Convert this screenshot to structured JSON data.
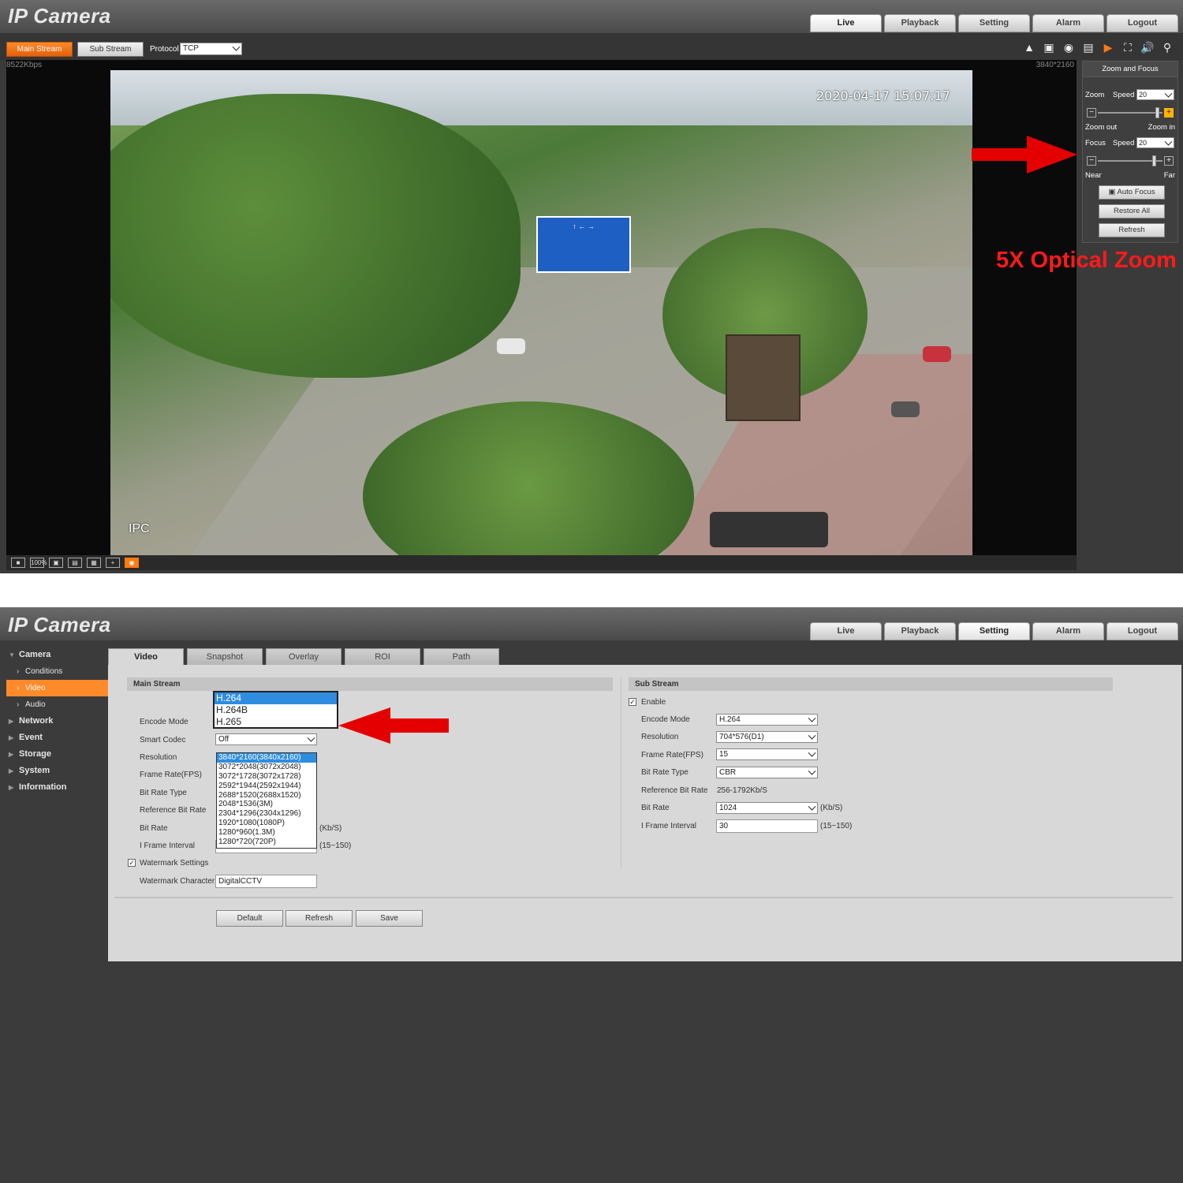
{
  "top": {
    "logo": "IP Camera",
    "nav": [
      "Live",
      "Playback",
      "Setting",
      "Alarm",
      "Logout"
    ],
    "active_nav": "Live",
    "main_stream": "Main Stream",
    "sub_stream": "Sub Stream",
    "protocol_label": "Protocol",
    "protocol_value": "TCP",
    "bitrate": "8522Kbps",
    "resolution": "3840*2160",
    "osd_time": "2020-04-17 15:07:17",
    "osd_name": "IPC",
    "zoom_focus": {
      "title": "Zoom and Focus",
      "zoom_label": "Zoom",
      "speed_label": "Speed",
      "zoom_speed": "20",
      "zoom_out": "Zoom out",
      "zoom_in": "Zoom in",
      "focus_label": "Focus",
      "focus_speed": "20",
      "near": "Near",
      "far": "Far",
      "auto_focus": "Auto Focus",
      "restore_all": "Restore All",
      "refresh": "Refresh"
    },
    "promo": "5X Optical Zoom",
    "viewbar_zoom": "100%"
  },
  "bottom": {
    "logo": "IP Camera",
    "nav": [
      "Live",
      "Playback",
      "Setting",
      "Alarm",
      "Logout"
    ],
    "active_nav": "Setting",
    "sidebar": {
      "camera": "Camera",
      "conditions": "Conditions",
      "video": "Video",
      "audio": "Audio",
      "network": "Network",
      "event": "Event",
      "storage": "Storage",
      "system": "System",
      "information": "Information"
    },
    "tabs": [
      "Video",
      "Snapshot",
      "Overlay",
      "ROI",
      "Path"
    ],
    "main_stream": {
      "header": "Main Stream",
      "encode_mode_label": "Encode Mode",
      "encode_options": [
        "H.264",
        "H.264B",
        "H.265"
      ],
      "smart_codec_label": "Smart Codec",
      "smart_codec_value": "Off",
      "resolution_label": "Resolution",
      "resolution_options": [
        "3840*2160(3840x2160)",
        "3072*2048(3072x2048)",
        "3072*1728(3072x1728)",
        "2592*1944(2592x1944)",
        "2688*1520(2688x1520)",
        "2048*1536(3M)",
        "2304*1296(2304x1296)",
        "1920*1080(1080P)",
        "1280*960(1.3M)",
        "1280*720(720P)"
      ],
      "frame_rate_label": "Frame Rate(FPS)",
      "bit_rate_type_label": "Bit Rate Type",
      "ref_bit_rate_label": "Reference Bit Rate",
      "bit_rate_label": "Bit Rate",
      "bit_rate_unit": "(Kb/S)",
      "iframe_label": "I Frame Interval",
      "iframe_range": "(15~150)",
      "watermark_settings": "Watermark Settings",
      "watermark_char_label": "Watermark Character",
      "watermark_char_value": "DigitalCCTV"
    },
    "sub_stream": {
      "header": "Sub Stream",
      "enable_label": "Enable",
      "encode_mode_label": "Encode Mode",
      "encode_mode_value": "H.264",
      "resolution_label": "Resolution",
      "resolution_value": "704*576(D1)",
      "frame_rate_label": "Frame Rate(FPS)",
      "frame_rate_value": "15",
      "bit_rate_type_label": "Bit Rate Type",
      "bit_rate_type_value": "CBR",
      "ref_bit_rate_label": "Reference Bit Rate",
      "ref_bit_rate_value": "256-1792Kb/S",
      "bit_rate_label": "Bit Rate",
      "bit_rate_value": "1024",
      "bit_rate_unit": "(Kb/S)",
      "iframe_label": "I Frame Interval",
      "iframe_value": "30",
      "iframe_range": "(15~150)"
    },
    "buttons": {
      "default": "Default",
      "refresh": "Refresh",
      "save": "Save"
    }
  },
  "colors": {
    "accent": "#ff8a2a",
    "arrow": "#e50000",
    "selection": "#2f8de0"
  }
}
